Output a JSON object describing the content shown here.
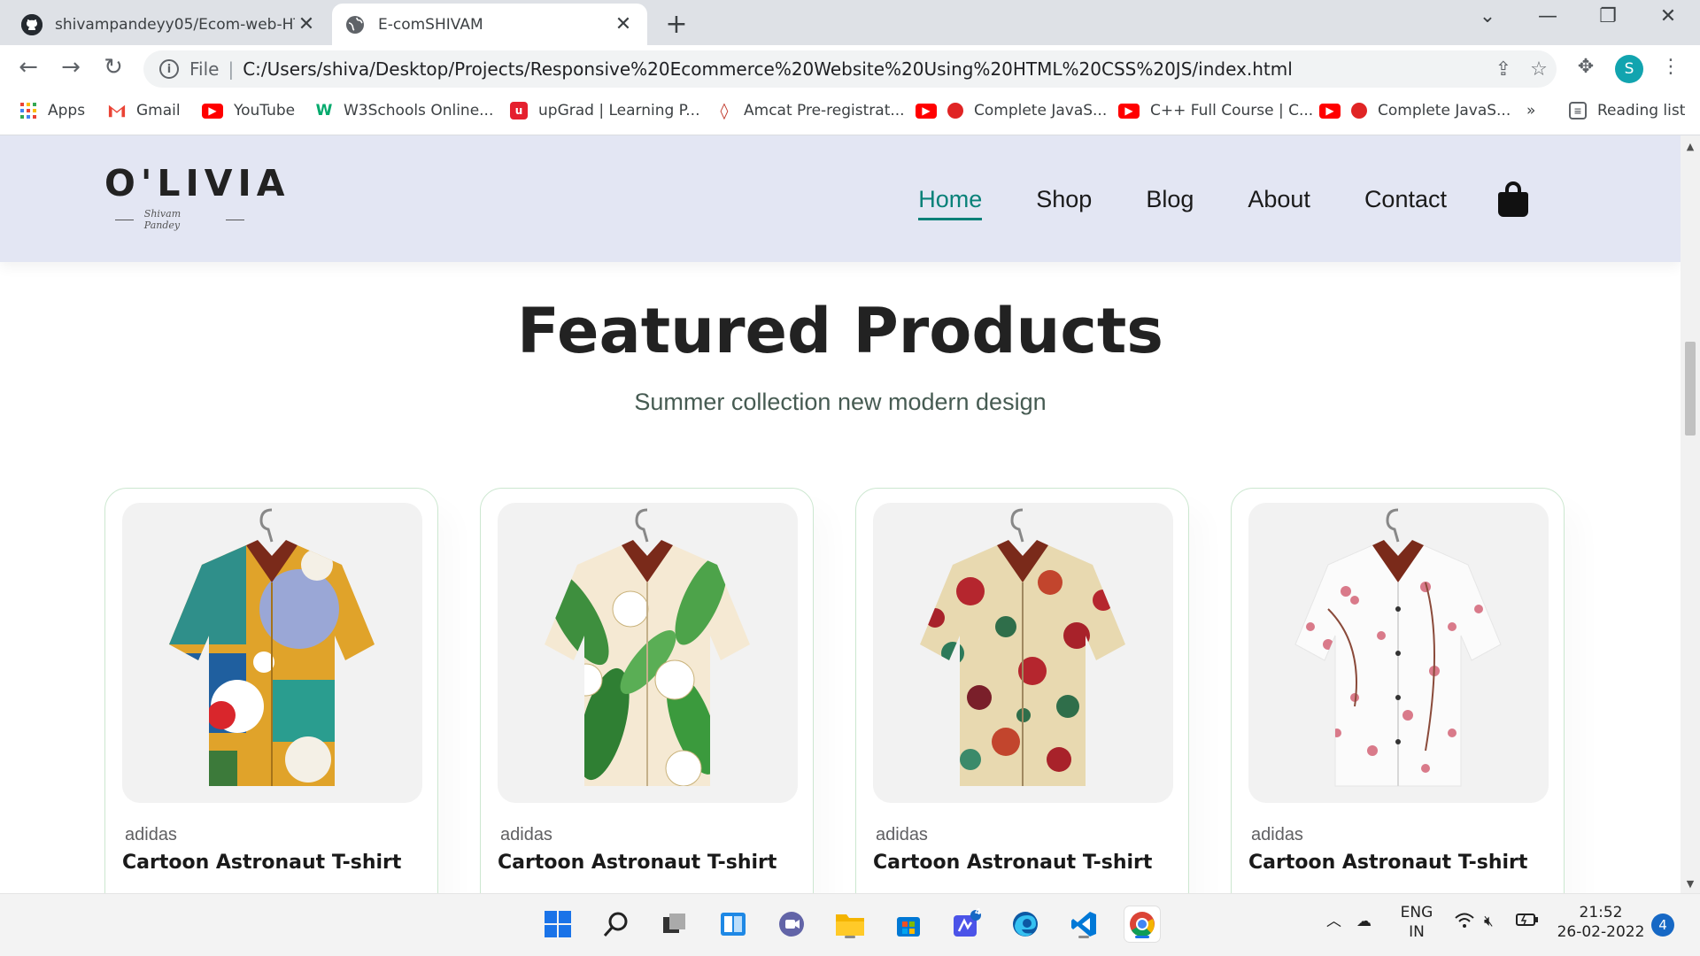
{
  "browser": {
    "tabs": [
      {
        "title": "shivampandeyy05/Ecom-web-HTML",
        "active": false,
        "icon": "github-icon"
      },
      {
        "title": "E-comSHIVAM",
        "active": true,
        "icon": "globe-icon"
      }
    ],
    "address": {
      "scheme_label": "File",
      "url": "C:/Users/shiva/Desktop/Projects/Responsive%20Ecommerce%20Website%20Using%20HTML%20CSS%20JS/index.html"
    },
    "profile_initial": "S",
    "bookmarks": [
      {
        "label": "Apps",
        "icon": "apps-grid-icon"
      },
      {
        "label": "Gmail",
        "icon": "gmail-icon"
      },
      {
        "label": "YouTube",
        "icon": "youtube-icon"
      },
      {
        "label": "W3Schools Online...",
        "icon": "w3schools-icon"
      },
      {
        "label": "upGrad | Learning P...",
        "icon": "upgrad-icon"
      },
      {
        "label": "Amcat Pre-registrat...",
        "icon": "amcat-icon"
      },
      {
        "label": "Complete JavaS...",
        "icon": "youtube-icon"
      },
      {
        "label": "C++ Full Course | C...",
        "icon": "youtube-icon"
      },
      {
        "label": "Complete JavaS...",
        "icon": "youtube-icon"
      }
    ],
    "bookmarks_overflow": "»",
    "reading_list": "Reading list"
  },
  "site": {
    "logo": {
      "brand": "O'LIVIA",
      "tagline": "Shivam Pandey"
    },
    "nav": [
      {
        "label": "Home",
        "active": true
      },
      {
        "label": "Shop",
        "active": false
      },
      {
        "label": "Blog",
        "active": false
      },
      {
        "label": "About",
        "active": false
      },
      {
        "label": "Contact",
        "active": false
      }
    ],
    "accent_color": "#088178",
    "header_bg": "#e3e6f3",
    "featured": {
      "title": "Featured Products",
      "subtitle": "Summer collection new modern design"
    },
    "products": [
      {
        "brand": "adidas",
        "name": "Cartoon Astronaut T-shirt",
        "pattern": "multicolor-abstract"
      },
      {
        "brand": "adidas",
        "name": "Cartoon Astronaut T-shirt",
        "pattern": "green-lily-floral"
      },
      {
        "brand": "adidas",
        "name": "Cartoon Astronaut T-shirt",
        "pattern": "red-beige-floral"
      },
      {
        "brand": "adidas",
        "name": "Cartoon Astronaut T-shirt",
        "pattern": "pink-blossom-white"
      }
    ]
  },
  "taskbar": {
    "language": {
      "line1": "ENG",
      "line2": "IN"
    },
    "time": "21:52",
    "date": "26-02-2022",
    "notification_count": "4",
    "app_badge": "4"
  }
}
